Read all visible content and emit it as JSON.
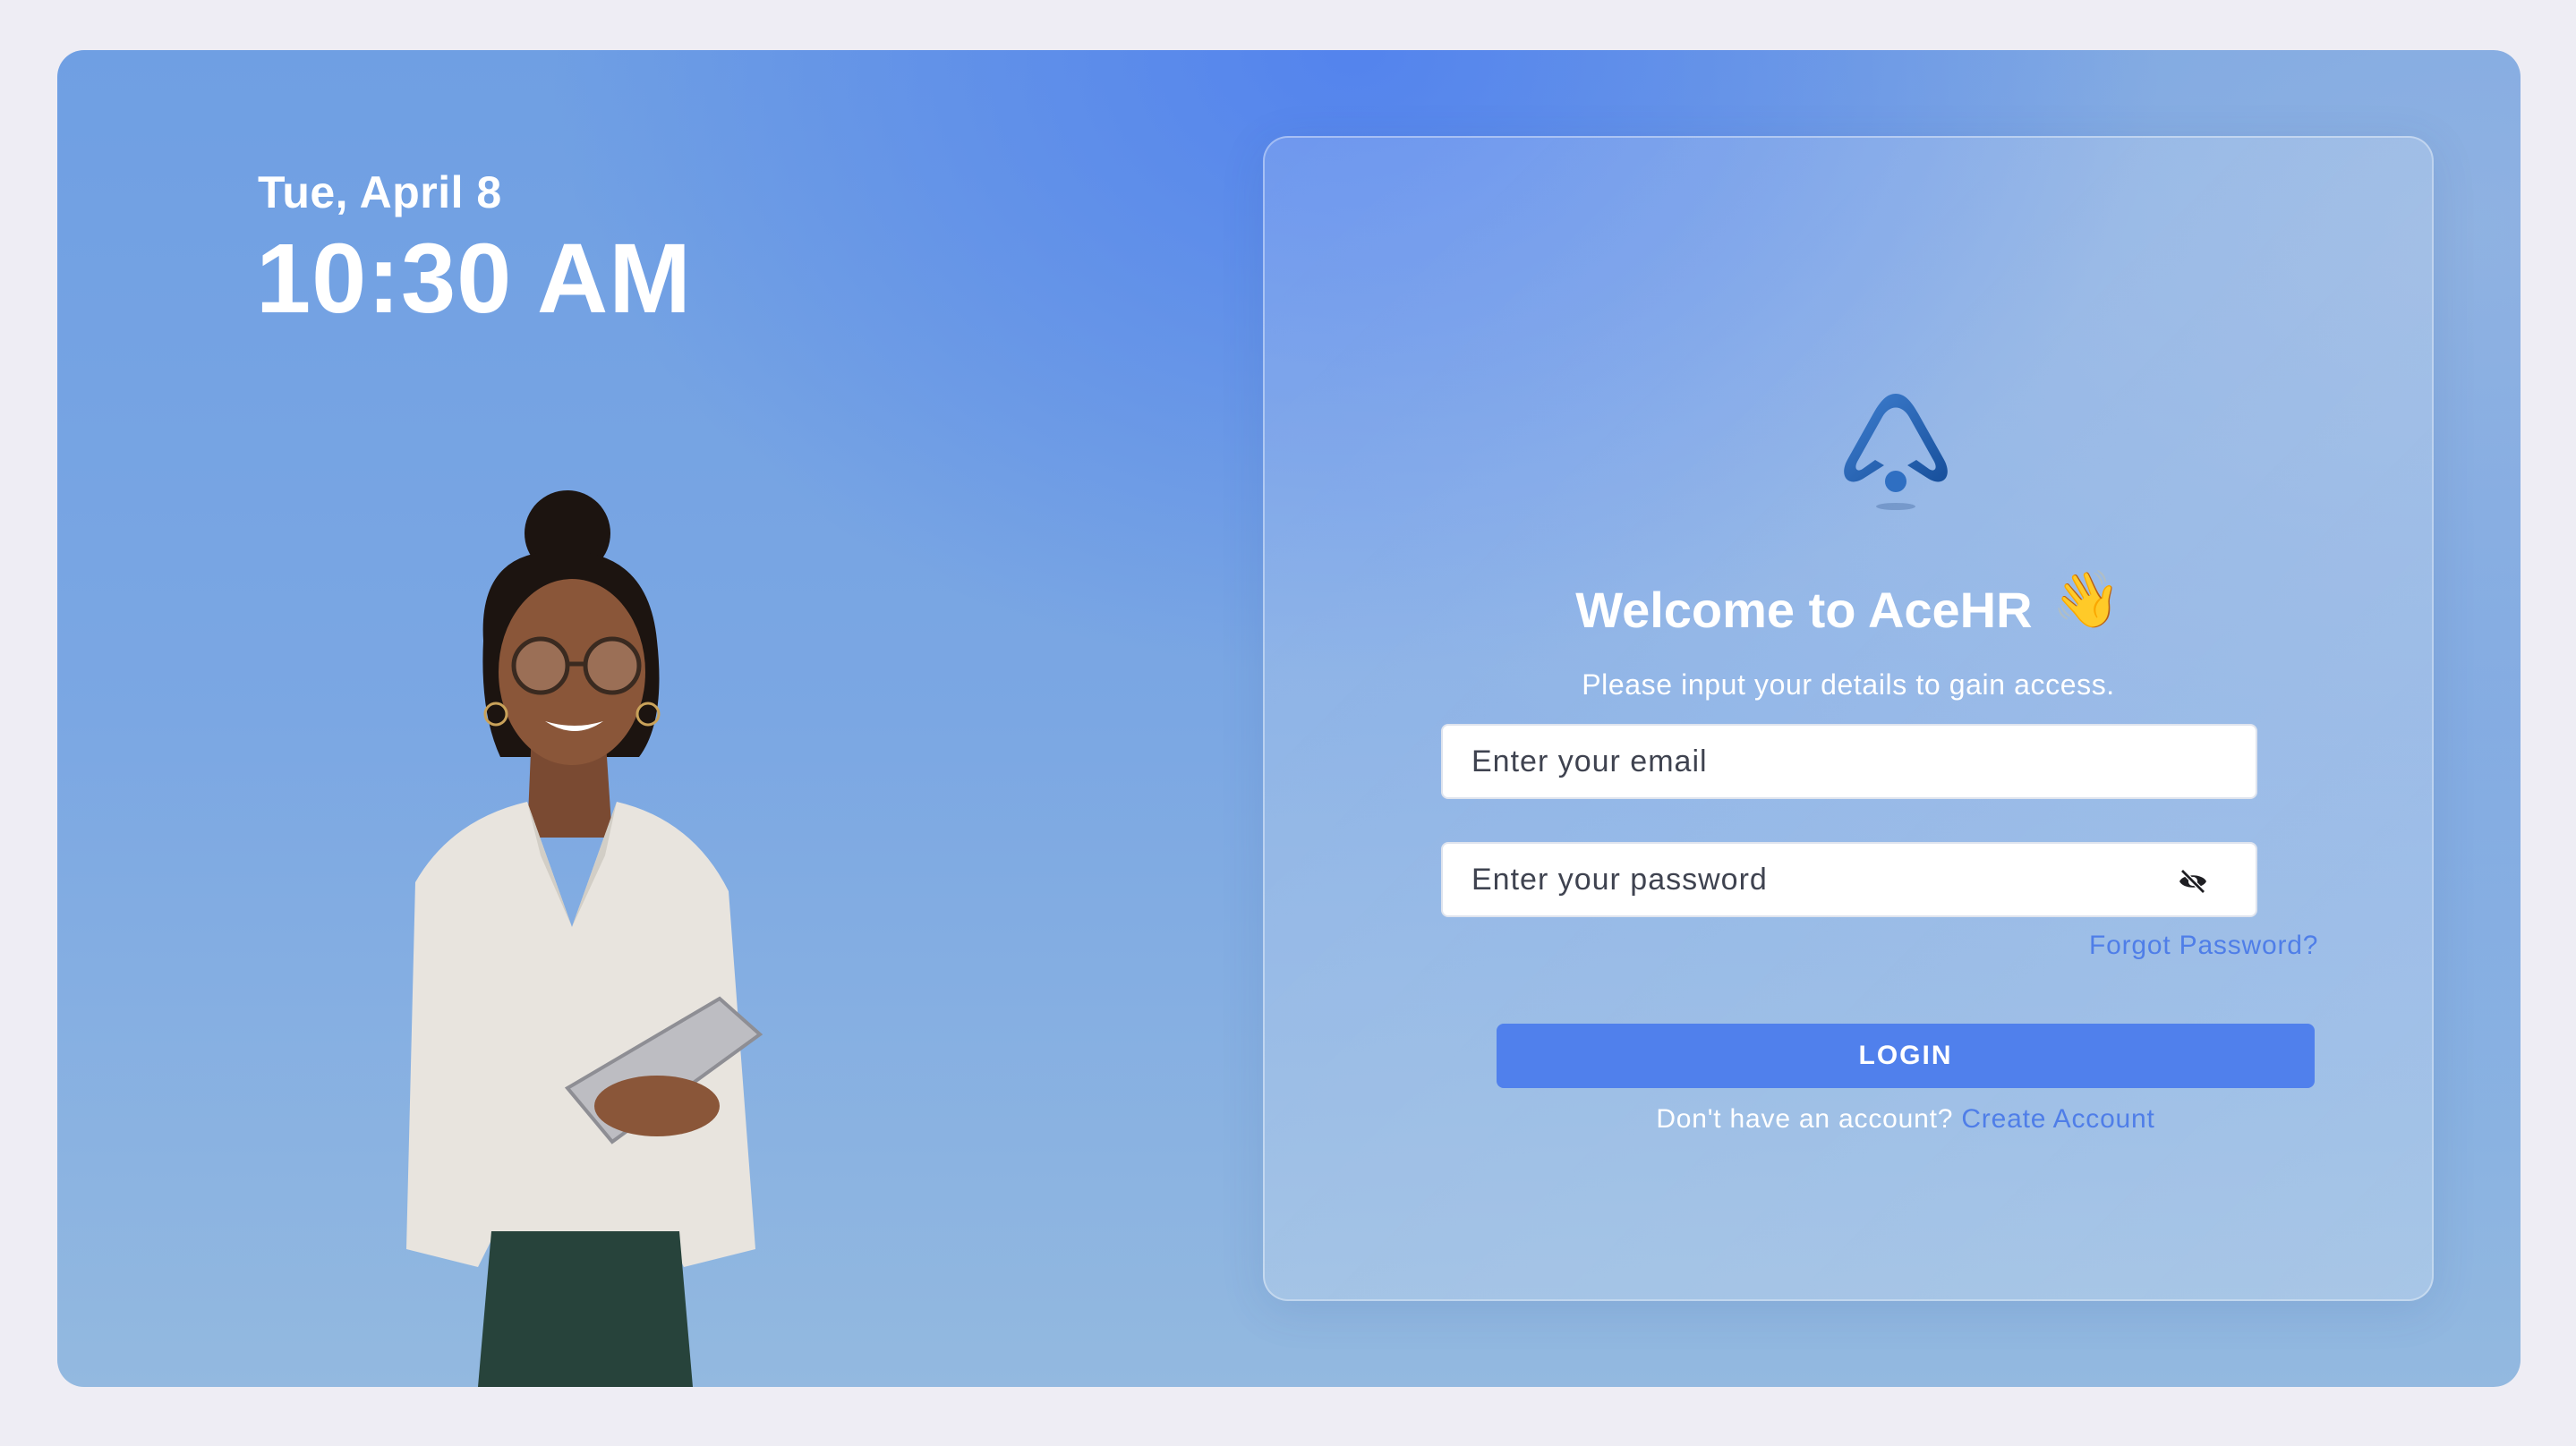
{
  "clock": {
    "date": "Tue, April 8",
    "time": "10:30 AM"
  },
  "login_card": {
    "logo_icon": "acehr-logo-icon",
    "welcome_title": "Welcome to AceHR",
    "wave_emoji": "👋",
    "subtitle": "Please input your details to gain access.",
    "email_placeholder": "Enter your email",
    "password_placeholder": "Enter your password",
    "password_toggle_icon": "eye-slash-icon",
    "forgot_password": "Forgot Password?",
    "login_button": "LOGIN",
    "no_account_text": "Don't have an account?",
    "create_account": "Create Account"
  },
  "colors": {
    "accent": "#5080ec",
    "link": "#4f7ee8",
    "page_background": "#eeedf4"
  }
}
